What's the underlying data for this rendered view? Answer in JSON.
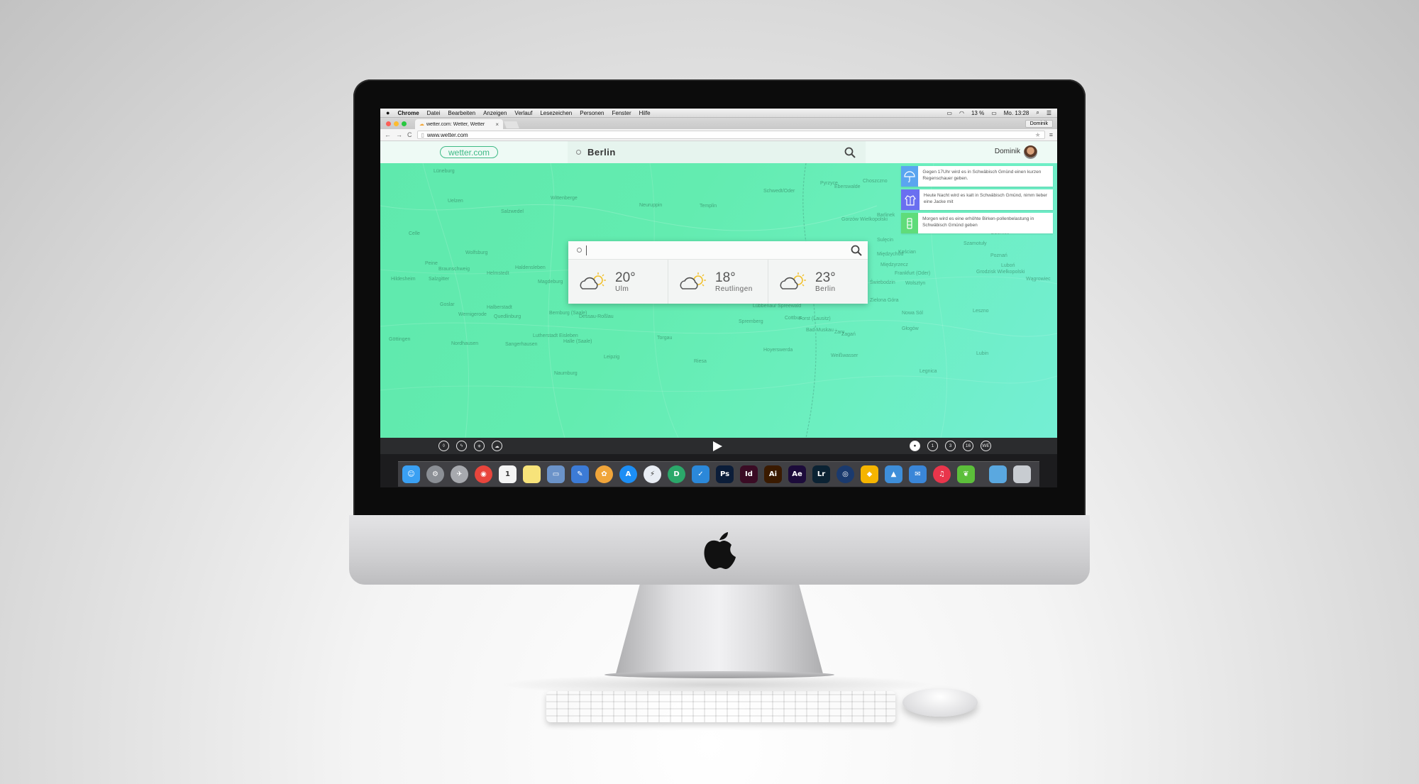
{
  "menubar": {
    "apple": "",
    "items": [
      "Chrome",
      "Datei",
      "Bearbeiten",
      "Anzeigen",
      "Verlauf",
      "Lesezeichen",
      "Personen",
      "Fenster",
      "Hilfe"
    ],
    "battery": "13 %",
    "clock": "Mo. 13:28"
  },
  "browser": {
    "tab_title": "wetter.com: Wetter, Wetter",
    "tab_close": "×",
    "profile": "Dominik",
    "url": "www.wetter.com",
    "back": "←",
    "forward": "→",
    "reload": "C",
    "star": "★",
    "menu": "≡"
  },
  "site": {
    "logo": "wetter.com",
    "location": "Berlin",
    "user_name": "Dominik",
    "notifications": [
      {
        "icon": "umbrella-icon",
        "color": "#5aa5f0",
        "text": "Gegen 17Uhr wird es in Schwäbisch Gmünd einen kurzen Regenschauer geben."
      },
      {
        "icon": "jacket-icon",
        "color": "#6a6ff0",
        "text": "Heute Nacht wird es kalt in Schwäbisch Gmünd, nimm lieber eine Jacke mit"
      },
      {
        "icon": "pollen-icon",
        "color": "#5fdc7a",
        "text": "Morgen wird es eine erhöhte Birken-pollenbelastung in Schwäbisch Gmünd geben"
      }
    ],
    "search_placeholder": "",
    "cities": [
      {
        "temp": "20°",
        "name": "Ulm"
      },
      {
        "temp": "18°",
        "name": "Reutlingen"
      },
      {
        "temp": "23°",
        "name": "Berlin"
      }
    ],
    "map_labels": [
      "Lüneburg",
      "Uelzen",
      "Salzwedel",
      "Wittenberge",
      "Neuruppin",
      "Templin",
      "Schwedt/Oder",
      "Pyrzyce",
      "Choszczno",
      "Gorzów Wielkopolski",
      "Celle",
      "Wolfsburg",
      "Peine",
      "Braunschweig",
      "Hildesheim",
      "Salzgitter",
      "Helmstedt",
      "Haldensleben",
      "Magdeburg",
      "Oranienburg",
      "Frankfurt (Oder)",
      "Goslar",
      "Halberstadt",
      "Wernigerode",
      "Quedlinburg",
      "Bernburg (Saale)",
      "Dessau-Roßlau",
      "Lübbenau/ Spreewald",
      "Cottbus",
      "Guben",
      "Zielona Góra",
      "Żary",
      "Żagań",
      "Göttingen",
      "Nordhausen",
      "Sangerhausen",
      "Halle (Saale)",
      "Lutherstadt Eisleben",
      "Torgau",
      "Riesa",
      "Spremberg",
      "Leipzig",
      "Naumburg",
      "Poznań",
      "Luboń",
      "Leszno",
      "Głogów",
      "Lubin",
      "Legnica",
      "Wolsztyn",
      "Nowa Sól",
      "Grodzisk Wielkopolski",
      "Kościan",
      "Oborniki",
      "Szamotuły",
      "Międzychód",
      "Hoyerswerda",
      "Bad Muskau",
      "Weißwasser",
      "Forst (Lausitz)",
      "Eberswalde",
      "Prenzlau",
      "Barlinek",
      "Słubice",
      "Sulęcin",
      "Międzyrzecz",
      "Świebodzin",
      "Trzcianka",
      "Wągrowiec"
    ],
    "timeline": {
      "left_icons": [
        "drop-icon",
        "wind-icon",
        "sun-icon",
        "cloud-icon"
      ],
      "right_buttons": [
        "●",
        "1",
        "3",
        "16",
        "WE"
      ]
    }
  },
  "dock": {
    "apps": [
      {
        "name": "finder-icon",
        "color": "#3aa0f3",
        "glyph": "☺"
      },
      {
        "name": "system-preferences-icon",
        "color": "#8b8f95",
        "glyph": "⚙"
      },
      {
        "name": "launchpad-icon",
        "color": "#a7a9ae",
        "glyph": "✈"
      },
      {
        "name": "chrome-icon",
        "color": "#e8453c",
        "glyph": "◉"
      },
      {
        "name": "calendar-icon",
        "color": "#f4f4f4",
        "glyph": "1"
      },
      {
        "name": "notes-icon",
        "color": "#f7e37a",
        "glyph": ""
      },
      {
        "name": "preview-icon",
        "color": "#6b93c9",
        "glyph": "▭"
      },
      {
        "name": "xcode-icon",
        "color": "#3c7bd6",
        "glyph": "✎"
      },
      {
        "name": "photos-icon",
        "color": "#f0a53a",
        "glyph": "✿"
      },
      {
        "name": "app-store-icon",
        "color": "#1c8ef5",
        "glyph": "A"
      },
      {
        "name": "messenger-icon",
        "color": "#e8edf4",
        "glyph": "⚡"
      },
      {
        "name": "dispatch-icon",
        "color": "#2ba86a",
        "glyph": "D"
      },
      {
        "name": "wunderlist-icon",
        "color": "#2b88d9",
        "glyph": "✓"
      },
      {
        "name": "photoshop-icon",
        "color": "#0b1d39",
        "glyph": "Ps"
      },
      {
        "name": "indesign-icon",
        "color": "#3a0b24",
        "glyph": "Id"
      },
      {
        "name": "illustrator-icon",
        "color": "#3a1a00",
        "glyph": "Ai"
      },
      {
        "name": "after-effects-icon",
        "color": "#1c0b3a",
        "glyph": "Ae"
      },
      {
        "name": "lightroom-icon",
        "color": "#0b2233",
        "glyph": "Lr"
      },
      {
        "name": "cinema4d-icon",
        "color": "#1a3a6e",
        "glyph": "◎"
      },
      {
        "name": "sketch-icon",
        "color": "#f5b400",
        "glyph": "◆"
      },
      {
        "name": "image-capture-icon",
        "color": "#3e8ed9",
        "glyph": "▲"
      },
      {
        "name": "mail-icon",
        "color": "#3a86d8",
        "glyph": "✉"
      },
      {
        "name": "itunes-icon",
        "color": "#e9354b",
        "glyph": "♫"
      },
      {
        "name": "evernote-icon",
        "color": "#5cbf3a",
        "glyph": "❦"
      }
    ],
    "folder": {
      "name": "downloads-folder-icon",
      "color": "#5aa8e0",
      "glyph": ""
    },
    "trash": {
      "name": "trash-icon",
      "color": "#c8ccd1",
      "glyph": ""
    }
  },
  "colors": {
    "brand": "#3fba86",
    "map_start": "#5fe9ad",
    "map_end": "#74eed4",
    "timeline_bg": "#2b2c2e"
  }
}
